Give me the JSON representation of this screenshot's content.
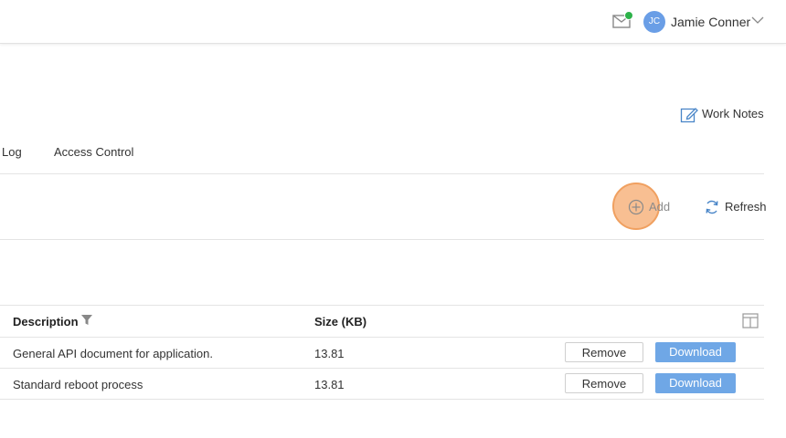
{
  "header": {
    "user_initials": "JC",
    "user_name": "Jamie Conner",
    "icons": {
      "mail": "mail-icon",
      "notification_dot": "green",
      "dropdown": "chevron-down-icon"
    }
  },
  "work_notes": {
    "label": "Work Notes",
    "icon": "edit-note-icon"
  },
  "tabs": [
    {
      "label": "Log"
    },
    {
      "label": "Access Control"
    }
  ],
  "actions": {
    "add_label": "Add",
    "refresh_label": "Refresh",
    "highlight_color": "#f6aa6e"
  },
  "table": {
    "columns": [
      {
        "label": "Description"
      },
      {
        "label": "Size (KB)"
      }
    ],
    "rows": [
      {
        "description": "General API document for application.",
        "size": "13.81",
        "remove_label": "Remove",
        "download_label": "Download"
      },
      {
        "description": "Standard reboot process",
        "size": "13.81",
        "remove_label": "Remove",
        "download_label": "Download"
      }
    ]
  },
  "colors": {
    "accent": "#6fa7e6",
    "avatar": "#6a9ee6"
  }
}
